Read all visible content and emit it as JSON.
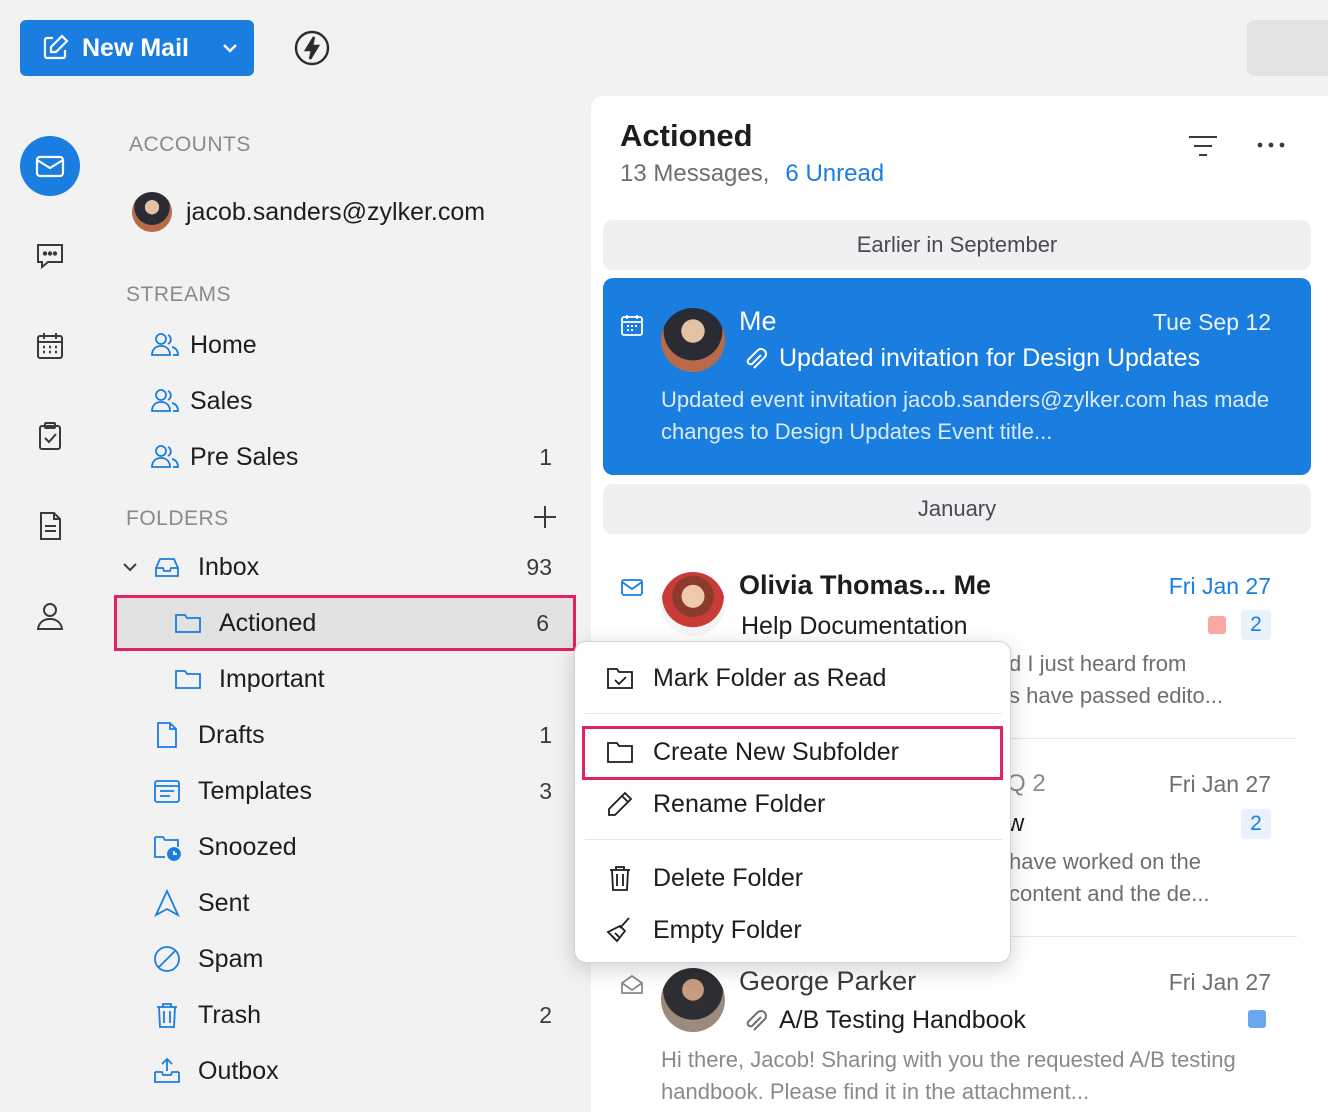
{
  "toolbar": {
    "new_mail_label": "New Mail"
  },
  "sidebar": {
    "accounts_head": "ACCOUNTS",
    "account_email": "jacob.sanders@zylker.com",
    "streams_head": "STREAMS",
    "streams": [
      {
        "label": "Home",
        "count": ""
      },
      {
        "label": "Sales",
        "count": ""
      },
      {
        "label": "Pre Sales",
        "count": "1"
      }
    ],
    "folders_head": "FOLDERS",
    "folders": [
      {
        "label": "Inbox",
        "count": "93",
        "icon": "inbox-icon"
      },
      {
        "label": "Actioned",
        "count": "6",
        "icon": "folder-icon"
      },
      {
        "label": "Important",
        "count": "",
        "icon": "folder-icon"
      },
      {
        "label": "Drafts",
        "count": "1",
        "icon": "draft-icon"
      },
      {
        "label": "Templates",
        "count": "3",
        "icon": "template-icon"
      },
      {
        "label": "Snoozed",
        "count": "",
        "icon": "snooze-icon"
      },
      {
        "label": "Sent",
        "count": "",
        "icon": "sent-icon"
      },
      {
        "label": "Spam",
        "count": "",
        "icon": "spam-icon"
      },
      {
        "label": "Trash",
        "count": "2",
        "icon": "trash-icon"
      },
      {
        "label": "Outbox",
        "count": "",
        "icon": "outbox-icon"
      }
    ]
  },
  "list": {
    "title": "Actioned",
    "messages_count": "13 Messages,",
    "unread": "6 Unread",
    "groups": [
      "Earlier in September",
      "January"
    ],
    "messages": [
      {
        "sender": "Me",
        "date": "Tue Sep 12",
        "subject": "Updated invitation for  Design Updates",
        "preview": "Updated event invitation jacob.sanders@zylker.com has made changes to Design Updates Event title..."
      },
      {
        "sender": "Olivia Thomas... Me",
        "date": "Fri Jan 27",
        "subject": "Help Documentation",
        "badge": "2",
        "preview_right": [
          "d I just heard from",
          "s have passed edito..."
        ]
      },
      {
        "sender_tail": "Q 2",
        "date": "Fri Jan 27",
        "subject_tail": "w",
        "badge": "2",
        "preview_right": [
          "have worked on the",
          "content and the de..."
        ]
      },
      {
        "sender": "George Parker",
        "date": "Fri Jan 27",
        "subject": "A/B Testing Handbook",
        "preview": "Hi there, Jacob! Sharing with you the requested A/B testing handbook. Please find it in the attachment..."
      }
    ]
  },
  "context_menu": {
    "items": [
      {
        "label": "Mark Folder as Read"
      },
      {
        "label": "Create New Subfolder"
      },
      {
        "label": "Rename Folder"
      },
      {
        "label": "Delete Folder"
      },
      {
        "label": "Empty Folder"
      }
    ]
  },
  "colors": {
    "accent": "#1a7de0",
    "highlight": "#e0245e"
  }
}
